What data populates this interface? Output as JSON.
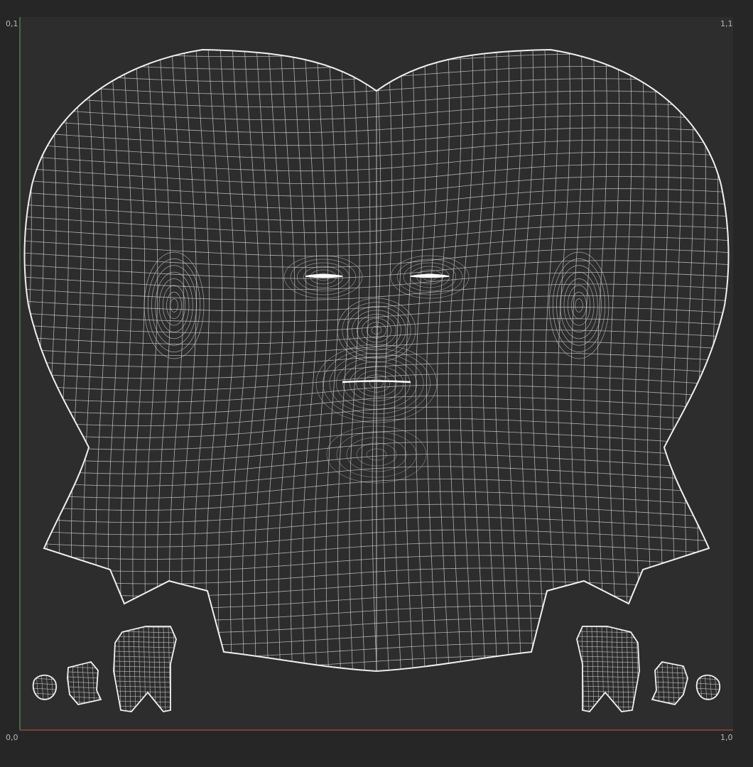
{
  "corner_labels": {
    "top_left": "0,1",
    "top_right": "1,1",
    "bottom_left": "0,0",
    "bottom_right": "1,0"
  },
  "colors": {
    "background": "#262626",
    "canvas": "#2d2d2d",
    "wireframe": "#e6e6e6",
    "u_axis": "#b04a4a",
    "v_axis": "#4a9a5a"
  },
  "uv_islands": [
    "head-shell",
    "left-ear-outer",
    "left-ear-mid",
    "left-ear-small",
    "right-ear-outer",
    "right-ear-mid",
    "right-ear-small"
  ]
}
